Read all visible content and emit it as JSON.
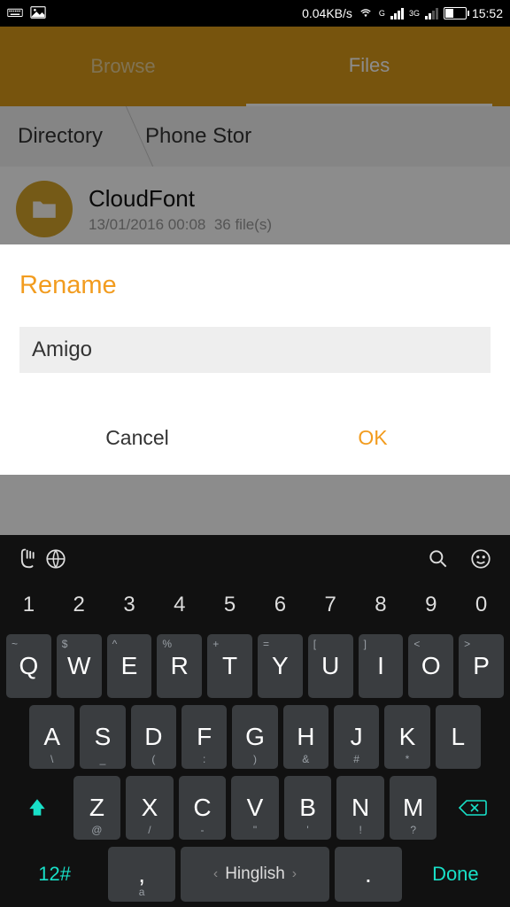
{
  "statusbar": {
    "speed": "0.04KB/s",
    "time": "15:52",
    "net_label_left": "G",
    "net_label_right": "3G"
  },
  "header": {
    "tabs": [
      "Browse",
      "Files"
    ],
    "active_index": 1
  },
  "breadcrumbs": [
    "Directory",
    "Phone Stor"
  ],
  "folder": {
    "name": "CloudFont",
    "date": "13/01/2016 00:08",
    "meta": "36 file(s)"
  },
  "dialog": {
    "title": "Rename",
    "value": "Amigo",
    "cancel": "Cancel",
    "ok": "OK"
  },
  "keyboard": {
    "numbers": [
      "1",
      "2",
      "3",
      "4",
      "5",
      "6",
      "7",
      "8",
      "9",
      "0"
    ],
    "row2": [
      {
        "k": "Q",
        "s": "~"
      },
      {
        "k": "W",
        "s": "$"
      },
      {
        "k": "E",
        "s": "^"
      },
      {
        "k": "R",
        "s": "%"
      },
      {
        "k": "T",
        "s": "+"
      },
      {
        "k": "Y",
        "s": "="
      },
      {
        "k": "U",
        "s": "["
      },
      {
        "k": "I",
        "s": "]"
      },
      {
        "k": "O",
        "s": "<"
      },
      {
        "k": "P",
        "s": ">"
      }
    ],
    "row3": [
      {
        "k": "A",
        "s": "\\"
      },
      {
        "k": "S",
        "s": "_"
      },
      {
        "k": "D",
        "s": "("
      },
      {
        "k": "F",
        "s": ":"
      },
      {
        "k": "G",
        "s": ")"
      },
      {
        "k": "H",
        "s": "&"
      },
      {
        "k": "J",
        "s": "#"
      },
      {
        "k": "K",
        "s": "*"
      },
      {
        "k": "L",
        "s": ""
      }
    ],
    "row4": [
      {
        "k": "Z",
        "s": "@"
      },
      {
        "k": "X",
        "s": "/"
      },
      {
        "k": "C",
        "s": "-"
      },
      {
        "k": "V",
        "s": "\""
      },
      {
        "k": "B",
        "s": "'"
      },
      {
        "k": "N",
        "s": "!"
      },
      {
        "k": "M",
        "s": "?"
      }
    ],
    "sym": "12#",
    "lang": "Hinglish",
    "done": "Done",
    "comma": ",",
    "dot": "."
  }
}
